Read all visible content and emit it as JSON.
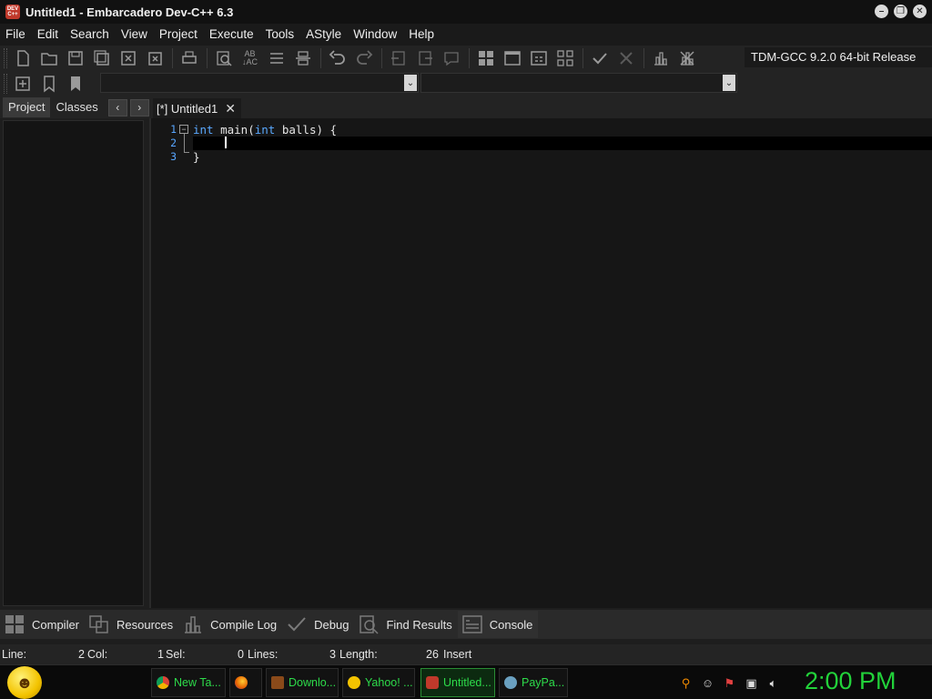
{
  "window": {
    "title": "Untitled1 - Embarcadero Dev-C++ 6.3",
    "app_icon_text": "DEV C++",
    "controls": [
      "minimize",
      "restore",
      "close"
    ]
  },
  "menu": [
    "File",
    "Edit",
    "Search",
    "View",
    "Project",
    "Execute",
    "Tools",
    "AStyle",
    "Window",
    "Help"
  ],
  "toolbar": {
    "compiler": "TDM-GCC 9.2.0 64-bit Release"
  },
  "left_panel": {
    "tabs": [
      "Project",
      "Classes"
    ],
    "active_tab": "Project",
    "prev_arrow": "‹",
    "next_arrow": "›"
  },
  "editor": {
    "tab_label": "[*] Untitled1",
    "tab_close": "✕",
    "line_numbers": [
      "1",
      "2",
      "3"
    ],
    "lines": [
      "int main(int balls) {",
      "",
      "}"
    ],
    "keyword_color": "#5aa9ff"
  },
  "bottom_tabs": [
    "Compiler",
    "Resources",
    "Compile Log",
    "Debug",
    "Find Results",
    "Console"
  ],
  "status": {
    "line_label": "Line:",
    "line_value": "2",
    "col_label": "Col:",
    "col_value": "1",
    "sel_label": "Sel:",
    "sel_value": "0",
    "lines_label": "Lines:",
    "lines_value": "3",
    "length_label": "Length:",
    "length_value": "26",
    "mode": "Insert"
  },
  "taskbar": {
    "items": [
      {
        "label": "New Ta...",
        "icon": "chrome-icon"
      },
      {
        "label": "",
        "icon": "firefox-icon"
      },
      {
        "label": "Downlo...",
        "icon": "download-icon"
      },
      {
        "label": "Yahoo! ...",
        "icon": "yahoo-icon"
      },
      {
        "label": "Untitled...",
        "icon": "devcpp-icon",
        "active": true
      },
      {
        "label": "PayPa...",
        "icon": "shield-icon"
      }
    ],
    "clock": "2:00 PM",
    "accent_color": "#22d23a"
  }
}
